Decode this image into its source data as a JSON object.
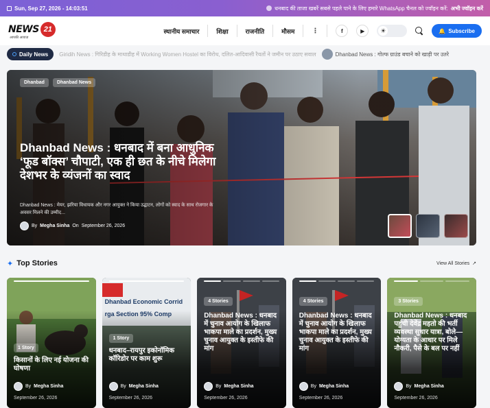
{
  "topbar": {
    "datetime": "Sun, Sep 27, 2026 - 14:03:51",
    "promo_text": "धनबाद की ताजा खबरें सबसे पहले पाने के लिए हमारे WhatsApp चैनल को ज्वॉइन करें:",
    "promo_cta": "अभी ज्वॉइन करें"
  },
  "header": {
    "logo_word": "NEWS",
    "logo_number": "21",
    "logo_tagline": "आपकी आवाज़",
    "nav": [
      "स्थानीय समाचार",
      "शिक्षा",
      "राजनीति",
      "मौसम"
    ],
    "more": "⋮",
    "social": [
      "f",
      "▶"
    ],
    "subscribe_label": "Subscribe"
  },
  "ticker": {
    "label": "Daily News",
    "items": [
      "Giridih News : गिरिडीह के माथाडीह में Working Women Hostel का विरोध, दलित-आदिवासी रैयतों ने जमीन पर उठाए सवाल",
      "Dhanbad News : गोल्फ ग्राउंड बचाने को खाड़ी पर उतरे"
    ]
  },
  "hero": {
    "categories": [
      "Dhanbad",
      "Dhanbad News"
    ],
    "title": "Dhanbad News : धनबाद में बना आधुनिक ‘फूड बॉक्स’ चौपाटी, एक ही छत के नीचे मिलेगा देशभर के व्यंजनों का स्वाद",
    "excerpt": "Dhanbad News : मेयर, झरिया विधायक और नगर आयुक्त ने किया उद्घाटन, लोगों को स्वाद के साथ रोजगार के अवसर मिलने की उम्मीद...",
    "author": "Megha Sinha",
    "on": "On",
    "date": "September 26, 2026"
  },
  "top_stories": {
    "title": "Top Stories",
    "view_all": "View All Stories",
    "cards": [
      {
        "count": "1 Story",
        "title": "किसानों के लिए नई योजना की घोषणा",
        "author": "Megha Sinha",
        "date": "September 26, 2026"
      },
      {
        "count": "1 Story",
        "title": "धनबाद–रायपुर इकोनॉमिक कॉरिडोर पर काम शुरू",
        "author": "Megha Sinha",
        "date": "September 26, 2026",
        "img_text": "Dhanbad Economic Corrid",
        "img_text2": "rga Section 95% Comp"
      },
      {
        "count": "4 Stories",
        "title": "Dhanbad News : धनबाद में चुनाव आयोग के खिलाफ भाकपा माले का प्रदर्शन, मुख्य चुनाव आयुक्त के इस्तीफे की मांग",
        "author": "Megha Sinha",
        "date": "September 26, 2026"
      },
      {
        "count": "4 Stories",
        "title": "Dhanbad News : धनबाद में चुनाव आयोग के खिलाफ भाकपा माले का प्रदर्शन, मुख्य चुनाव आयुक्त के इस्तीफे की मांग",
        "author": "Megha Sinha",
        "date": "September 26, 2026"
      },
      {
        "count": "3 Stories",
        "title": "Dhanbad News : धनबाद पहुंची देवेंद्र महतो की भर्ती व्यवस्था सुधार यात्रा, बोले— योग्यता के आधार पर मिले नौकरी, पैसे के बल पर नहीं",
        "author": "Megha Sinha",
        "date": "September 26, 2026"
      }
    ]
  },
  "colors": {
    "accent": "#1a6ef0",
    "logo_red": "#d62b2b",
    "ticker_label_bg": "#1f2a44"
  }
}
